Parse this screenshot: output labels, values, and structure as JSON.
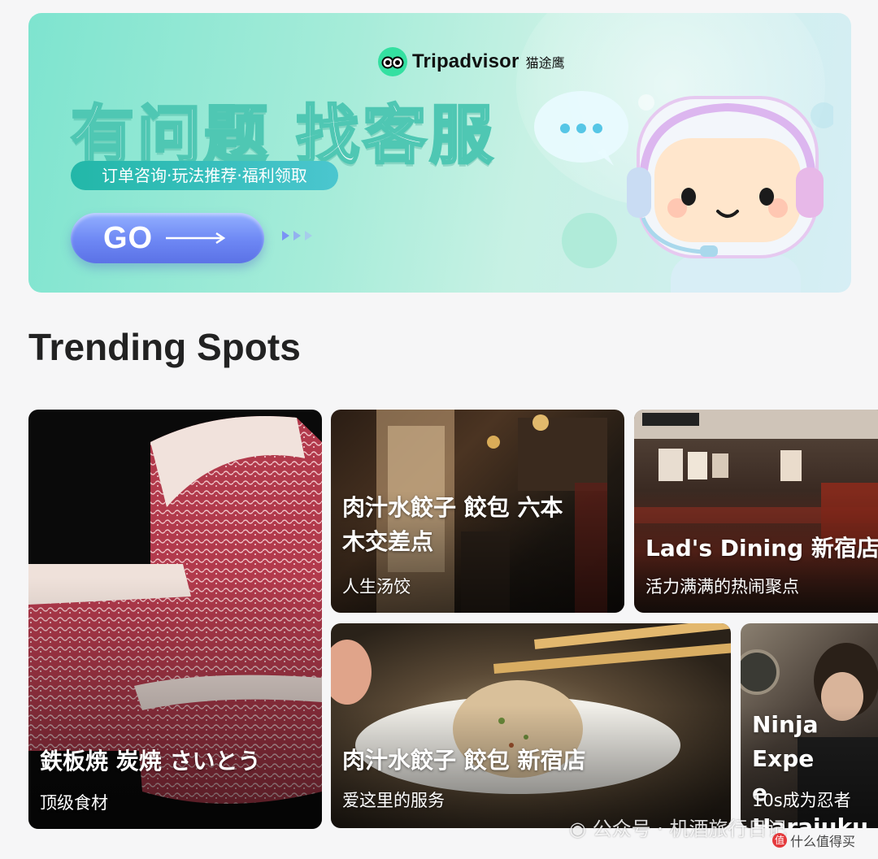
{
  "banner": {
    "brand_name": "Tripadvisor",
    "brand_cn": "猫途鹰",
    "headline": "有问题 找客服",
    "tagline": "订单咨询·玩法推荐·福利领取",
    "cta_label": "GO",
    "colors": {
      "brand_green": "#34e0a1",
      "cta_blue": "#6d87f4"
    }
  },
  "section": {
    "title": "Trending Spots"
  },
  "cards": [
    {
      "title": "鉄板焼 炭焼 さいとう",
      "subtitle": "顶级食材"
    },
    {
      "title": "肉汁水餃子 餃包 六本\n木交差点",
      "subtitle": "人生汤饺"
    },
    {
      "title": "Lad's Dining 新宿店",
      "subtitle": "活力满满的热闹聚点"
    },
    {
      "title": "肉汁水餃子 餃包 新宿店",
      "subtitle": "爱这里的服务"
    },
    {
      "title": "Ninja Expe\ne Harajuku",
      "subtitle": "10s成为忍者"
    }
  ],
  "watermark": {
    "text": "公众号 · 机酒旅行日记",
    "site": "什么值得买"
  }
}
